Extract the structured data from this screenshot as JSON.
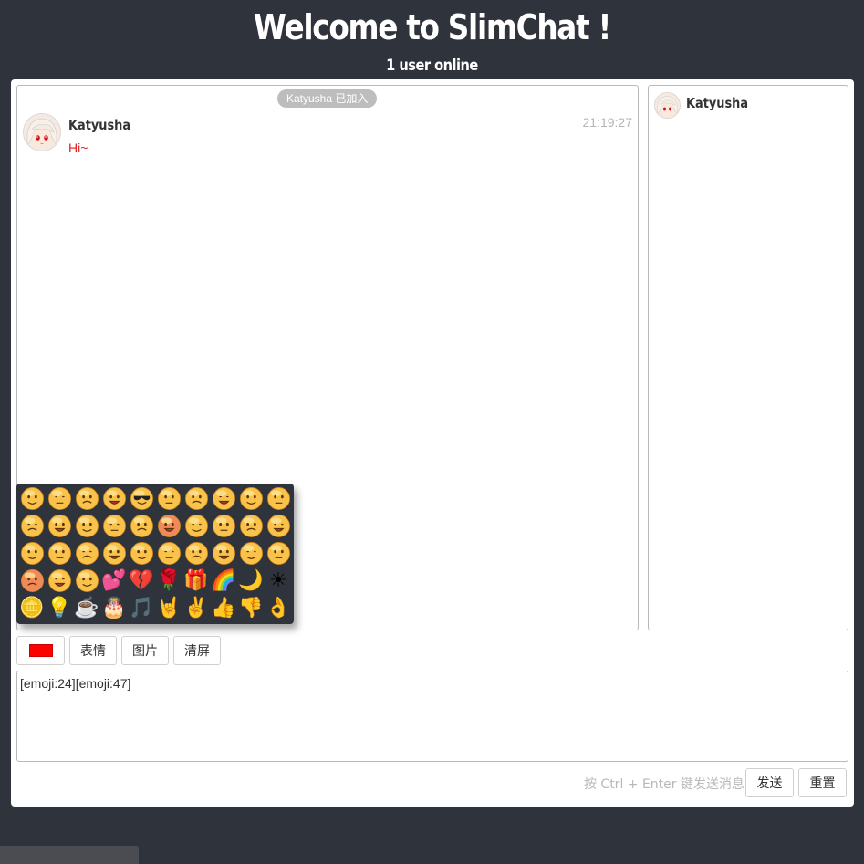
{
  "header": {
    "title": "Welcome to SlimChat !",
    "subtitle": "1 user online"
  },
  "chat": {
    "system_notice": "Katyusha 已加入",
    "messages": [
      {
        "name": "Katyusha",
        "time": "21:19:27",
        "text": "Hi~",
        "text_color": "#e02020"
      }
    ]
  },
  "users": [
    {
      "name": "Katyusha"
    }
  ],
  "emoji_panel": {
    "items": [
      "smile",
      "grin-tongue",
      "tongue-wink",
      "grimace",
      "sunglasses",
      "angry-teeth",
      "smirk",
      "sweat",
      "cry-laugh",
      "happy",
      "shy-cover",
      "frown",
      "annoyed",
      "money",
      "kiss",
      "angry",
      "sick",
      "bored",
      "dizzy",
      "heart-eyes",
      "blank",
      "wince",
      "squint",
      "giggle",
      "content",
      "laugh",
      "yell",
      "puppy",
      "sleepy",
      "scream",
      "cry",
      "shocked",
      "blow-kiss",
      "hearts",
      "broken-heart",
      "rose",
      "gift",
      "rainbow",
      "moon",
      "sun",
      "coins",
      "lightbulb",
      "coffee",
      "cake",
      "music",
      "rock-hand",
      "victory",
      "thumbs-up",
      "thumbs-down",
      "ok-hand"
    ]
  },
  "toolbar": {
    "text_color": "#ff0000",
    "emoji_label": "表情",
    "image_label": "图片",
    "clear_label": "清屏"
  },
  "input": {
    "value": "[emoji:24][emoji:47]"
  },
  "footer": {
    "hint": "按 Ctrl + Enter 键发送消息",
    "send_label": "发送",
    "reset_label": "重置"
  }
}
